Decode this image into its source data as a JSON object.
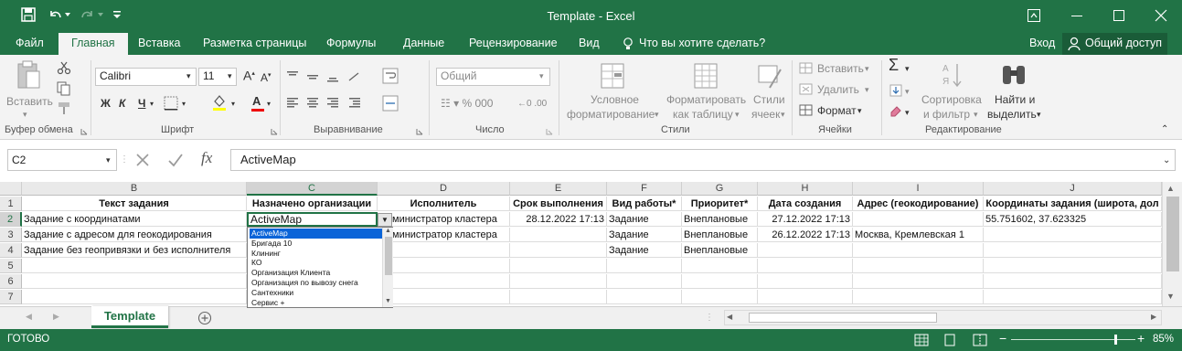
{
  "window": {
    "title": "Template - Excel"
  },
  "quick_access": {
    "save_icon": "save-icon",
    "undo_icon": "undo-icon",
    "redo_icon": "redo-icon",
    "customize_icon": "chevron-down-icon"
  },
  "window_controls": {
    "ribbon_display_icon": "ribbon-display-icon",
    "minimize_icon": "minimize-icon",
    "maximize_icon": "maximize-icon",
    "close_icon": "close-icon"
  },
  "tabs": [
    "Файл",
    "Главная",
    "Вставка",
    "Разметка страницы",
    "Формулы",
    "Данные",
    "Рецензирование",
    "Вид"
  ],
  "tell_me": "Что вы хотите сделать?",
  "signin": "Вход",
  "share": "Общий доступ",
  "ribbon": {
    "clipboard": {
      "paste": "Вставить",
      "label": "Буфер обмена"
    },
    "font": {
      "name": "Calibri",
      "size": "11",
      "bold": "Ж",
      "italic": "К",
      "underline": "Ч",
      "label": "Шрифт"
    },
    "alignment": {
      "label": "Выравнивание"
    },
    "number": {
      "format": "Общий",
      "label": "Число"
    },
    "styles": {
      "conditional_1": "Условное",
      "conditional_2": "форматирование",
      "table_1": "Форматировать",
      "table_2": "как таблицу",
      "cell_1": "Стили",
      "cell_2": "ячеек",
      "label": "Стили"
    },
    "cells": {
      "insert": "Вставить",
      "delete": "Удалить",
      "format": "Формат",
      "label": "Ячейки"
    },
    "editing": {
      "sort_1": "Сортировка",
      "sort_2": "и фильтр",
      "find_1": "Найти и",
      "find_2": "выделить",
      "label": "Редактирование"
    }
  },
  "formula_bar": {
    "name_box": "C2",
    "fx": "fx",
    "value": "ActiveMap"
  },
  "columns": [
    "B",
    "C",
    "D",
    "E",
    "F",
    "G",
    "H",
    "I",
    "J"
  ],
  "rows": [
    "1",
    "2",
    "3",
    "4",
    "5",
    "6",
    "7"
  ],
  "headers": [
    "Текст задания",
    "Назначено организации",
    "Исполнитель",
    "Срок выполнения",
    "Вид работы*",
    "Приоритет*",
    "Дата создания",
    "Адрес (геокодирование)",
    "Координаты задания (широта, дол"
  ],
  "data_rows": [
    [
      "Задание с координатами",
      "ActiveMap",
      "министратор кластера",
      "28.12.2022 17:13",
      "Задание",
      "Внеплановые",
      "27.12.2022 17:13",
      "",
      "55.751602, 37.623325"
    ],
    [
      "Задание с адресом для геокодирования",
      "",
      "министратор кластера",
      "",
      "Задание",
      "Внеплановые",
      "26.12.2022 17:13",
      "Москва, Кремлевская 1",
      ""
    ],
    [
      "Задание без геопривязки и без исполнителя",
      "",
      "",
      "",
      "Задание",
      "Внеплановые",
      "",
      "",
      ""
    ]
  ],
  "dropdown": {
    "selected": "ActiveMap",
    "items": [
      "ActiveMap",
      "Бригада 10",
      "Клининг",
      "КО",
      "Организация Клиента",
      "Организация по вывозу снега",
      "Сантехники",
      "Сервис +"
    ]
  },
  "sheet": {
    "tab": "Template"
  },
  "status": {
    "ready": "ГОТОВО",
    "zoom": "85%"
  }
}
